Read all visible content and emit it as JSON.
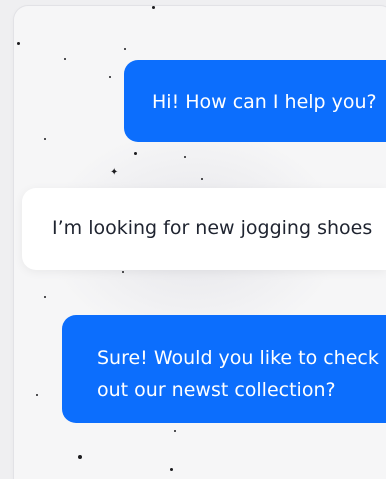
{
  "chat": {
    "messages": [
      {
        "sender": "bot",
        "text": "Hi! How can I help you?"
      },
      {
        "sender": "user",
        "text": "I’m looking for new jogging shoes"
      },
      {
        "sender": "bot",
        "text": "Sure! Would you like to check out our newst collection?"
      }
    ]
  },
  "colors": {
    "bot_bubble": "#0c6efd",
    "user_bubble": "#ffffff",
    "page_background": "#efeff1",
    "panel_background": "#f6f6f7"
  }
}
